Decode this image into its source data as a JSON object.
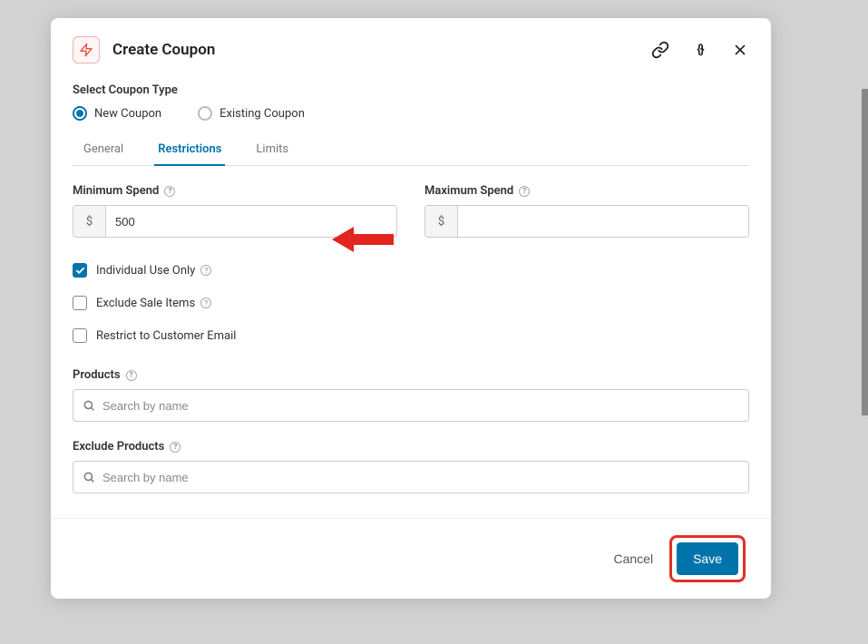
{
  "header": {
    "title": "Create Coupon"
  },
  "coupon_type": {
    "label": "Select Coupon Type",
    "options": {
      "new": "New Coupon",
      "existing": "Existing Coupon"
    }
  },
  "tabs": {
    "general": "General",
    "restrictions": "Restrictions",
    "limits": "Limits"
  },
  "fields": {
    "min_spend": {
      "label": "Minimum Spend",
      "prefix": "$",
      "value": "500"
    },
    "max_spend": {
      "label": "Maximum Spend",
      "prefix": "$",
      "value": ""
    },
    "individual_use": "Individual Use Only",
    "exclude_sale": "Exclude Sale Items",
    "restrict_email": "Restrict to Customer Email",
    "products": {
      "label": "Products",
      "placeholder": "Search by name"
    },
    "exclude_products": {
      "label": "Exclude Products",
      "placeholder": "Search by name"
    }
  },
  "footer": {
    "cancel": "Cancel",
    "save": "Save"
  }
}
